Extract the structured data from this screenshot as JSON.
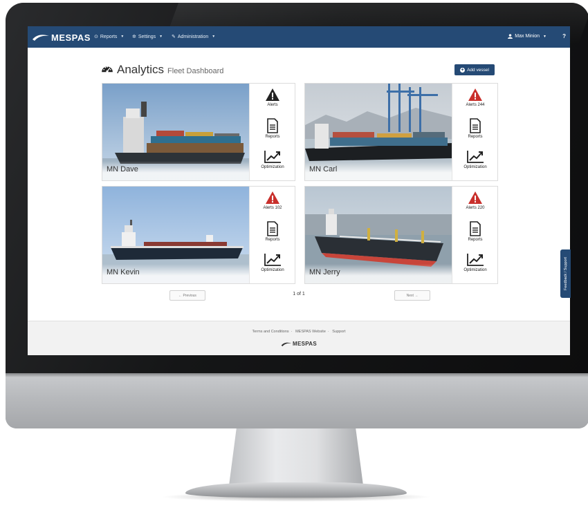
{
  "nav": {
    "brand": "MESPAS",
    "menu": [
      {
        "label": "Reports",
        "icon": "circle-dot-icon"
      },
      {
        "label": "Settings",
        "icon": "gear-icon"
      },
      {
        "label": "Administration",
        "icon": "wrench-icon"
      }
    ],
    "user": "Max Minion",
    "help": "?"
  },
  "page": {
    "title": "Analytics",
    "subtitle": "Fleet Dashboard",
    "add_button": "Add vessel"
  },
  "vessels": [
    {
      "name": "MN Dave",
      "alerts_label": "Alerts",
      "reports_label": "Reports",
      "optimization_label": "Optimization",
      "alert_color": "#222222"
    },
    {
      "name": "MN Carl",
      "alerts_label": "Alerts 244",
      "reports_label": "Reports",
      "optimization_label": "Optimization",
      "alert_color": "#c9302c"
    },
    {
      "name": "MN Kevin",
      "alerts_label": "Alerts 102",
      "reports_label": "Reports",
      "optimization_label": "Optimization",
      "alert_color": "#c9302c"
    },
    {
      "name": "MN Jerry",
      "alerts_label": "Alerts 220",
      "reports_label": "Reports",
      "optimization_label": "Optimization",
      "alert_color": "#c9302c"
    }
  ],
  "pagination": {
    "previous": "← Previous",
    "next": "Next →",
    "page": "1 of 1"
  },
  "footer": {
    "links": [
      "Terms and Conditions",
      "MESPAS Website",
      "Support"
    ],
    "logo": "MESPAS"
  },
  "feedback": "Feedback / Support",
  "colors": {
    "brand": "#254a75",
    "alert": "#c9302c"
  }
}
